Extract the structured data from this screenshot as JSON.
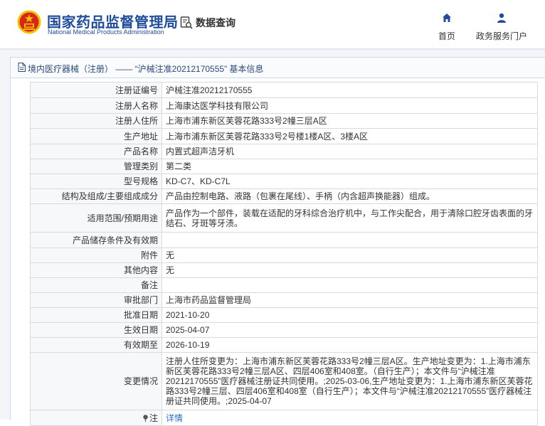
{
  "header": {
    "logo_cn": "国家药品监督管理局",
    "logo_en": "National Medical Products Administration",
    "data_query": "数据查询",
    "nav": [
      {
        "label": "首页",
        "icon": "home-icon"
      },
      {
        "label": "政务服务门户",
        "icon": "user-icon"
      }
    ]
  },
  "colors": {
    "brand": "#1f4d9b",
    "emblem_red": "#d8261c",
    "emblem_gold": "#f2c200",
    "link": "#2b6cc4"
  },
  "panel": {
    "title": "境内医疗器械（注册） —— “沪械注准20212170555” 基本信息"
  },
  "record": [
    {
      "label": "注册证编号",
      "value": "沪械注准20212170555"
    },
    {
      "label": "注册人名称",
      "value": "上海康达医学科技有限公司"
    },
    {
      "label": "注册人住所",
      "value": "上海市浦东新区芙蓉花路333号2幢三层A区"
    },
    {
      "label": "生产地址",
      "value": "上海市浦东新区芙蓉花路333号2号楼1楼A区、3楼A区"
    },
    {
      "label": "产品名称",
      "value": "内置式超声洁牙机"
    },
    {
      "label": "管理类别",
      "value": "第二类"
    },
    {
      "label": "型号规格",
      "value": "KD-C7、KD-C7L"
    },
    {
      "label": "结构及组成/主要组成成分",
      "value": "产品由控制电路、液路（包裹在尾线）、手柄（内含超声换能器）组成。"
    },
    {
      "label": "适用范围/预期用途",
      "value": "产品作为一个部件，装载在适配的牙科综合治疗机中，与工作尖配合，用于清除口腔牙齿表面的牙结石、牙斑等牙渍。"
    },
    {
      "label": "产品储存条件及有效期",
      "value": ""
    },
    {
      "label": "附件",
      "value": "无"
    },
    {
      "label": "其他内容",
      "value": "无"
    },
    {
      "label": "备注",
      "value": ""
    },
    {
      "label": "审批部门",
      "value": "上海市药品监督管理局"
    },
    {
      "label": "批准日期",
      "value": "2021-10-20"
    },
    {
      "label": "生效日期",
      "value": "2025-04-07"
    },
    {
      "label": "有效期至",
      "value": "2026-10-19"
    },
    {
      "label": "变更情况",
      "value": "注册人住所变更为：上海市浦东新区芙蓉花路333号2幢三层A区。生产地址变更为：1.上海市浦东新区芙蓉花路333号2幢三层A区、四层406室和408室。（自行生产）；本文件与“沪械注准20212170555”医疗器械注册证共同使用。;2025-03-06,生产地址变更为：1.上海市浦东新区芙蓉花路333号2幢三层、四层406室和408室（自行生产）；本文件与“沪械注准20212170555”医疗器械注册证共同使用。;2025-04-07"
    },
    {
      "label": "注",
      "value": "详情"
    }
  ]
}
